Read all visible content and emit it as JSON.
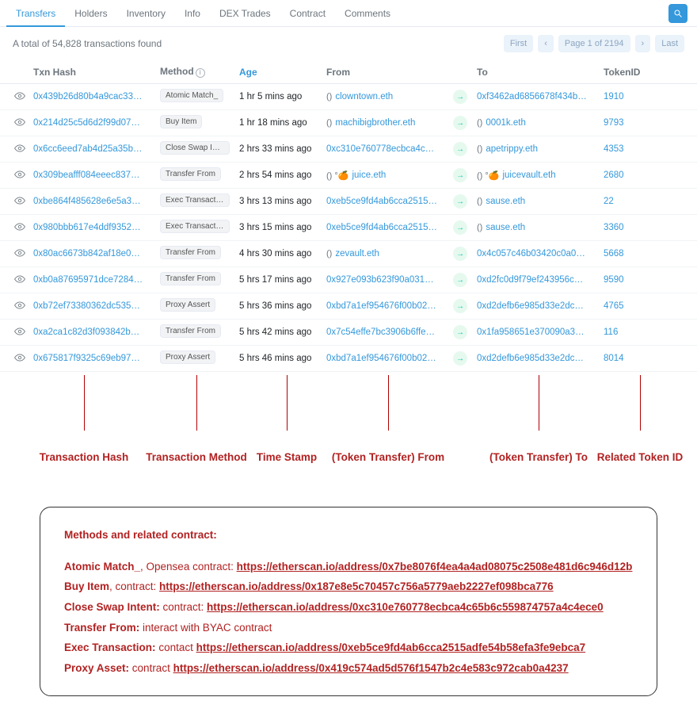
{
  "tabs": {
    "items": [
      "Transfers",
      "Holders",
      "Inventory",
      "Info",
      "DEX Trades",
      "Contract",
      "Comments"
    ],
    "active": "Transfers"
  },
  "summary": "A total of 54,828 transactions found",
  "pager": {
    "first": "First",
    "prev": "‹",
    "page": "Page 1 of 2194",
    "next": "›",
    "last": "Last"
  },
  "columns": {
    "hash": "Txn Hash",
    "method": "Method",
    "age": "Age",
    "from": "From",
    "to": "To",
    "token": "TokenID"
  },
  "rows": [
    {
      "hash": "0x439b26d80b4a9cac33…",
      "method": "Atomic Match_",
      "age": "1 hr 5 mins ago",
      "from": "clowntown.eth",
      "from_deco": "()",
      "to": "0xf3462ad6856678f434b…",
      "to_deco": "",
      "token": "1910"
    },
    {
      "hash": "0x214d25c5d6d2f99d07…",
      "method": "Buy Item",
      "age": "1 hr 18 mins ago",
      "from": "machibigbrother.eth",
      "from_deco": "()",
      "to": "0001k.eth",
      "to_deco": "()",
      "token": "9793"
    },
    {
      "hash": "0x6cc6eed7ab4d25a35b…",
      "method": "Close Swap Inten…",
      "age": "2 hrs 33 mins ago",
      "from": "0xc310e760778ecbca4c…",
      "from_deco": "",
      "to": "apetrippy.eth",
      "to_deco": "()",
      "token": "4353"
    },
    {
      "hash": "0x309beafff084eeec837…",
      "method": "Transfer From",
      "age": "2 hrs 54 mins ago",
      "from": "juice.eth",
      "from_deco": "() °🍊",
      "to": "juicevault.eth",
      "to_deco": "() °🍊",
      "token": "2680"
    },
    {
      "hash": "0xbe864f485628e6e5a3…",
      "method": "Exec Transaction",
      "age": "3 hrs 13 mins ago",
      "from": "0xeb5ce9fd4ab6cca2515…",
      "from_deco": "",
      "to": "sause.eth",
      "to_deco": "()",
      "token": "22"
    },
    {
      "hash": "0x980bbb617e4ddf9352…",
      "method": "Exec Transaction",
      "age": "3 hrs 15 mins ago",
      "from": "0xeb5ce9fd4ab6cca2515…",
      "from_deco": "",
      "to": "sause.eth",
      "to_deco": "()",
      "token": "3360"
    },
    {
      "hash": "0x80ac6673b842af18e0…",
      "method": "Transfer From",
      "age": "4 hrs 30 mins ago",
      "from": "zevault.eth",
      "from_deco": "()",
      "to": "0x4c057c46b03420c0a0…",
      "to_deco": "",
      "token": "5668"
    },
    {
      "hash": "0xb0a87695971dce7284…",
      "method": "Transfer From",
      "age": "5 hrs 17 mins ago",
      "from": "0x927e093b623f90a031…",
      "from_deco": "",
      "to": "0xd2fc0d9f79ef243956c…",
      "to_deco": "",
      "token": "9590"
    },
    {
      "hash": "0xb72ef73380362dc535…",
      "method": "Proxy Assert",
      "age": "5 hrs 36 mins ago",
      "from": "0xbd7a1ef954676f00b02…",
      "from_deco": "",
      "to": "0xd2defb6e985d33e2dc…",
      "to_deco": "",
      "token": "4765"
    },
    {
      "hash": "0xa2ca1c82d3f093842b…",
      "method": "Transfer From",
      "age": "5 hrs 42 mins ago",
      "from": "0x7c54effe7bc3906b6ffe…",
      "from_deco": "",
      "to": "0x1fa958651e370090a3…",
      "to_deco": "",
      "token": "116"
    },
    {
      "hash": "0x675817f9325c69eb97…",
      "method": "Proxy Assert",
      "age": "5 hrs 46 mins ago",
      "from": "0xbd7a1ef954676f00b02…",
      "from_deco": "",
      "to": "0xd2defb6e985d33e2dc…",
      "to_deco": "",
      "token": "8014"
    }
  ],
  "annot_labels": {
    "hash": "Transaction Hash",
    "method": "Transaction Method",
    "age": "Time Stamp",
    "from": "(Token Transfer) From",
    "to": "(Token Transfer)  To",
    "token": "Related Token ID"
  },
  "methods_box": {
    "title": "Methods and related contract:",
    "lines": [
      {
        "label": "Atomic Match_",
        "mid": ", Opensea contract: ",
        "url": "https://etherscan.io/address/0x7be8076f4ea4a4ad08075c2508e481d6c946d12b"
      },
      {
        "label": "Buy Item",
        "mid": ", contract: ",
        "url": "https://etherscan.io/address/0x187e8e5c70457c756a5779aeb2227ef098bca776"
      },
      {
        "label": "Close Swap Intent:",
        "mid": " contract: ",
        "url": "https://etherscan.io/address/0xc310e760778ecbca4c65b6c559874757a4c4ece0"
      },
      {
        "label": "Transfer From:",
        "mid": " interact with BYAC contract",
        "url": ""
      },
      {
        "label": "Exec Transaction:",
        "mid": " contact ",
        "url": "https://etherscan.io/address/0xeb5ce9fd4ab6cca2515adfe54b58efa3fe9ebca7"
      },
      {
        "label": "Proxy Asset:",
        "mid": " contract ",
        "url": "https://etherscan.io/address/0x419c574ad5d576f1547b2c4e583c972cab0a4237"
      }
    ]
  }
}
